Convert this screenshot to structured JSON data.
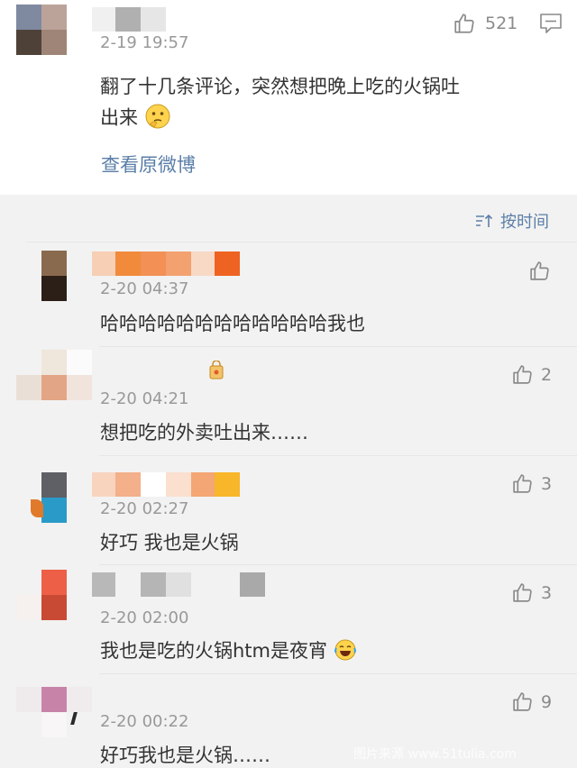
{
  "main_comment": {
    "timestamp": "2-19 19:57",
    "like_count": "521",
    "text_line1": "翻了十几条评论，突然想把晚上吃的火锅吐",
    "text_line2": "出来",
    "emoji_icon": "thinking-face-emoji",
    "view_original": "查看原微博"
  },
  "sort_bar": {
    "label": "按时间",
    "icon": "sort-icon"
  },
  "replies": [
    {
      "timestamp": "2-20 04:37",
      "text": "哈哈哈哈哈哈哈哈哈哈哈哈我也",
      "like_count": ""
    },
    {
      "timestamp": "2-20 04:21",
      "text": "想把吃的外卖吐出来……",
      "like_count": "2"
    },
    {
      "timestamp": "2-20 02:27",
      "text": "好巧 我也是火锅",
      "like_count": "3"
    },
    {
      "timestamp": "2-20 02:00",
      "text": "我也是吃的火锅htm是夜宵",
      "like_count": "3",
      "emoji_icon": "laughing-crying-emoji"
    },
    {
      "timestamp": "2-20 00:22",
      "text": "好巧我也是火锅……",
      "like_count": "9"
    }
  ],
  "watermark": "图片来源 www.51tulia.com",
  "colors": {
    "link": "#5b7fa8",
    "timestamp": "#999999",
    "background": "#f2f2f2",
    "card": "#ffffff"
  }
}
